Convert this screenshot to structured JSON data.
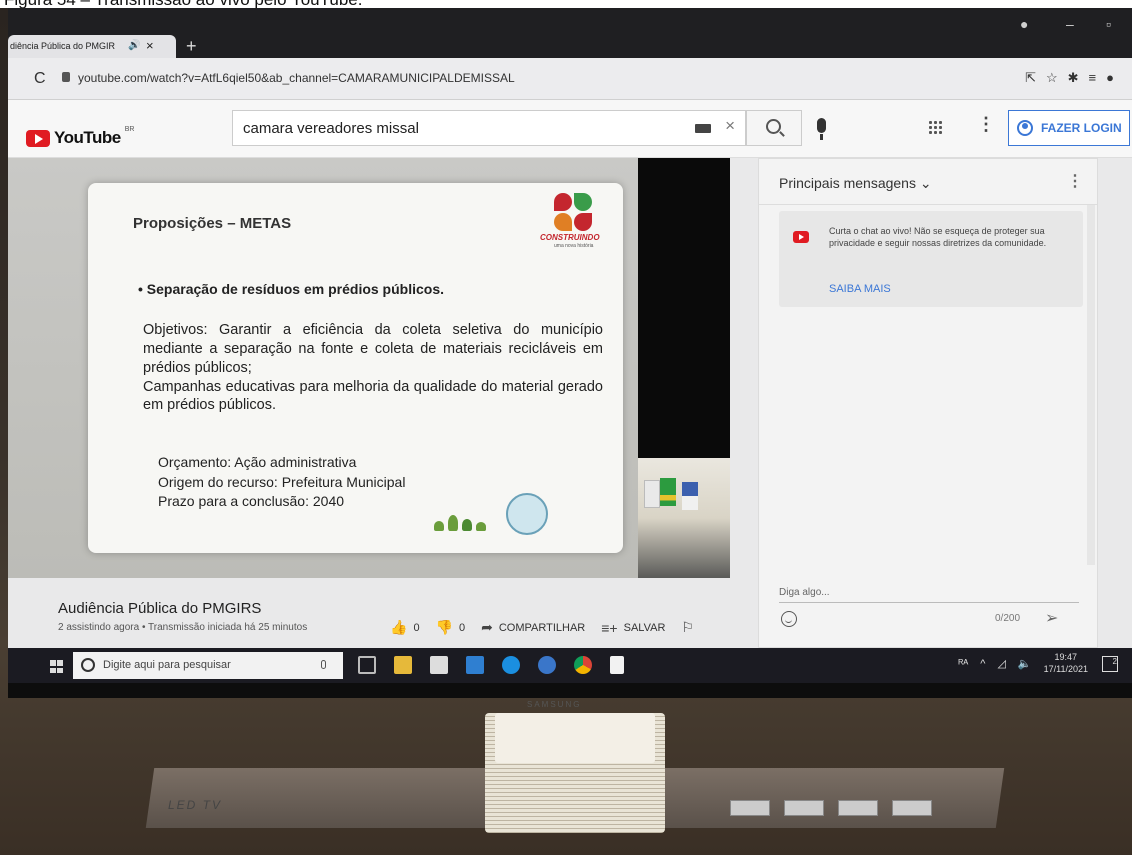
{
  "caption": "Figura 54 – Transmissão ao vivo pelo YouTube.",
  "browser": {
    "tab_title": "diência Pública do PMGIR",
    "url": "youtube.com/watch?v=AtfL6qiel50&ab_channel=CAMARAMUNICIPALDEMISSAL"
  },
  "youtube": {
    "logo": "YouTube",
    "region": "BR",
    "search_value": "camara vereadores missal",
    "login_label": "FAZER LOGIN"
  },
  "slide": {
    "title": "Proposições – METAS",
    "brand": "CONSTRUINDO",
    "brand_sub": "uma nova história",
    "bullet": "Separação de resíduos em prédios públicos.",
    "body_1": "Objetivos: Garantir a eficiência da coleta seletiva do município mediante a separação na fonte e coleta de materiais recicláveis em prédios públicos;",
    "body_2": "Campanhas educativas para melhoria da qualidade do material gerado em prédios públicos.",
    "budget": "Orçamento: Ação administrativa",
    "source": "Origem do recurso: Prefeitura Municipal",
    "deadline": "Prazo para a conclusão: 2040"
  },
  "video": {
    "title": "Audiência Pública do PMGIRS",
    "meta": "2 assistindo agora • Transmissão iniciada há 25 minutos",
    "likes": "0",
    "dislikes": "0",
    "share_label": "COMPARTILHAR",
    "save_label": "SALVAR"
  },
  "chat": {
    "title": "Principais mensagens",
    "notice": "Curta o chat ao vivo! Não se esqueça de proteger sua privacidade e seguir nossas diretrizes da comunidade.",
    "link": "SAIBA MAIS",
    "placeholder": "Diga algo...",
    "counter": "0/200"
  },
  "taskbar": {
    "search_placeholder": "Digite aqui para pesquisar",
    "time": "19:47",
    "date": "17/11/2021",
    "notifications": "2"
  },
  "monitor": {
    "brand": "SAMSUNG",
    "stand_label": "LED TV"
  },
  "colors": {
    "youtube_red": "#e01b22",
    "link_blue": "#3b77d6",
    "taskbar": "#1b1b22"
  }
}
